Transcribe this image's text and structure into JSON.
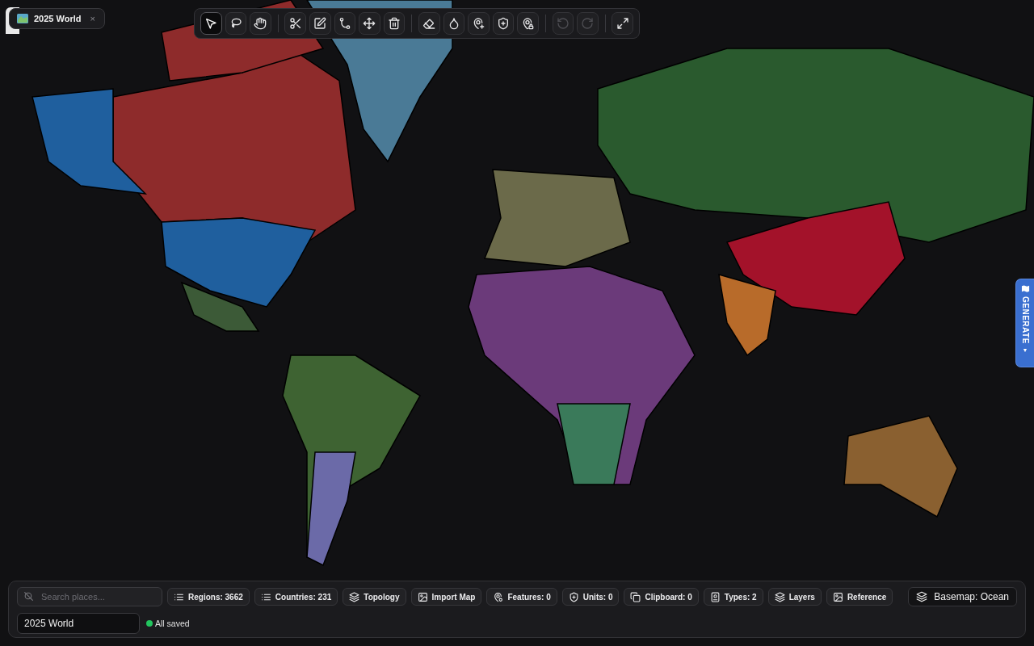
{
  "document_tab": {
    "title": "2025 World",
    "close": "×"
  },
  "toolbar": {
    "groups": [
      [
        {
          "selected": true,
          "disabled": false
        },
        {
          "selected": false,
          "disabled": false
        },
        {
          "selected": false,
          "disabled": false
        }
      ],
      [
        {
          "selected": false,
          "disabled": false
        },
        {
          "selected": false,
          "disabled": false
        },
        {
          "selected": false,
          "disabled": false
        },
        {
          "selected": false,
          "disabled": false
        },
        {
          "selected": false,
          "disabled": false
        }
      ],
      [
        {
          "selected": false,
          "disabled": false
        },
        {
          "selected": false,
          "disabled": false
        },
        {
          "selected": false,
          "disabled": false
        },
        {
          "selected": false,
          "disabled": false
        },
        {
          "selected": false,
          "disabled": false
        }
      ],
      [
        {
          "selected": false,
          "disabled": true
        },
        {
          "selected": false,
          "disabled": true
        }
      ],
      [
        {
          "selected": false,
          "disabled": false
        }
      ]
    ]
  },
  "generate_tab": {
    "label": "GENERATE",
    "caret": "▼"
  },
  "bottom_panel": {
    "search": {
      "placeholder": "Search places..."
    },
    "chips": [
      {
        "label": "Regions: 3662"
      },
      {
        "label": "Countries: 231"
      },
      {
        "label": "Topology"
      },
      {
        "label": "Import Map"
      },
      {
        "label": "Features: 0"
      },
      {
        "label": "Units: 0"
      },
      {
        "label": "Clipboard: 0"
      },
      {
        "label": "Types: 2"
      },
      {
        "label": "Layers"
      },
      {
        "label": "Reference"
      }
    ],
    "basemap_button": {
      "label": "Basemap: Ocean"
    },
    "map_name": {
      "value": "2025 World"
    },
    "save_status": {
      "label": "All saved",
      "saved": true
    }
  }
}
